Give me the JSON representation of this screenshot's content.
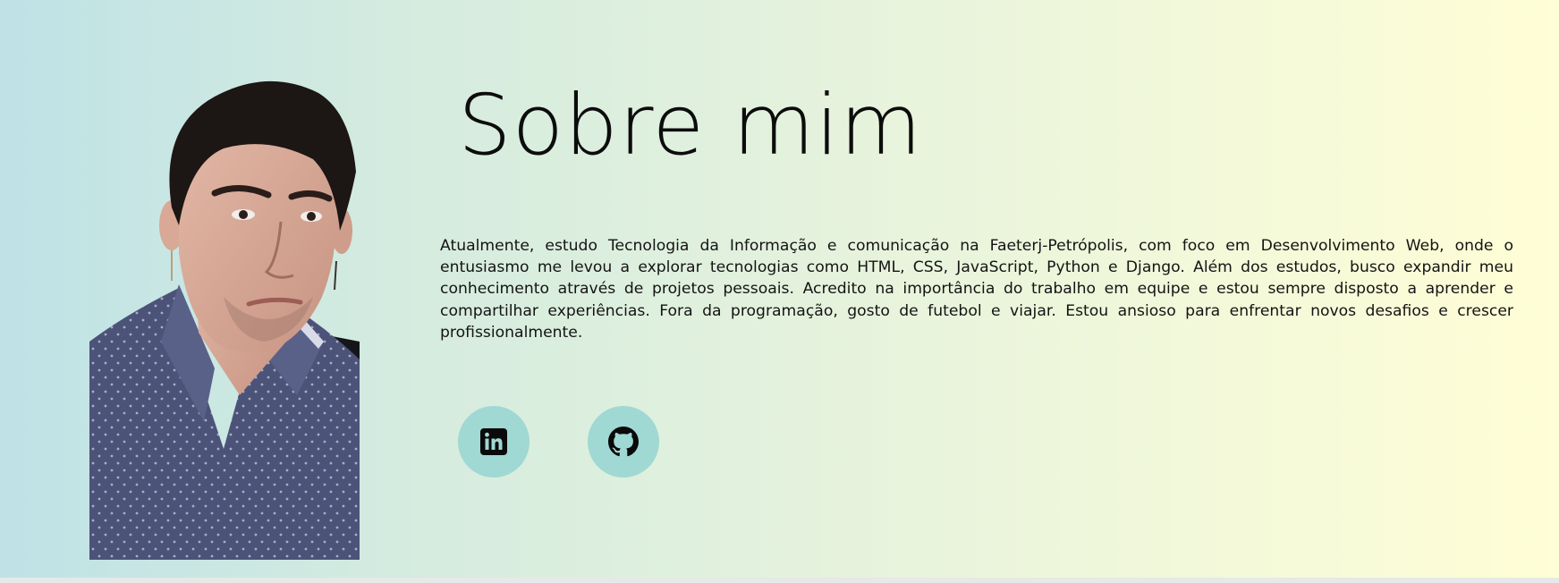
{
  "about": {
    "title": "Sobre mim",
    "bio": "Atualmente, estudo Tecnologia da Informação e comunicação na Faeterj-Petrópolis, com foco em Desenvolvimento Web, onde o entusiasmo me levou a explorar tecnologias como HTML, CSS, JavaScript, Python e Django. Além dos estudos, busco expandir meu conhecimento através de projetos pessoais. Acredito na importância do trabalho em equipe e estou sempre disposto a aprender e compartilhar experiências. Fora da programação, gosto de futebol e viajar. Estou ansioso para enfrentar novos desafios e crescer profissionalmente."
  },
  "portrait": {
    "icon": "profile-photo"
  },
  "social": {
    "links": [
      {
        "icon": "linkedin-icon"
      },
      {
        "icon": "github-icon"
      }
    ]
  },
  "colors": {
    "background_left": "#bfe2e6",
    "background_right": "#fffed6",
    "social_circle": "#a0d8d3",
    "text": "#0c0c0c"
  }
}
